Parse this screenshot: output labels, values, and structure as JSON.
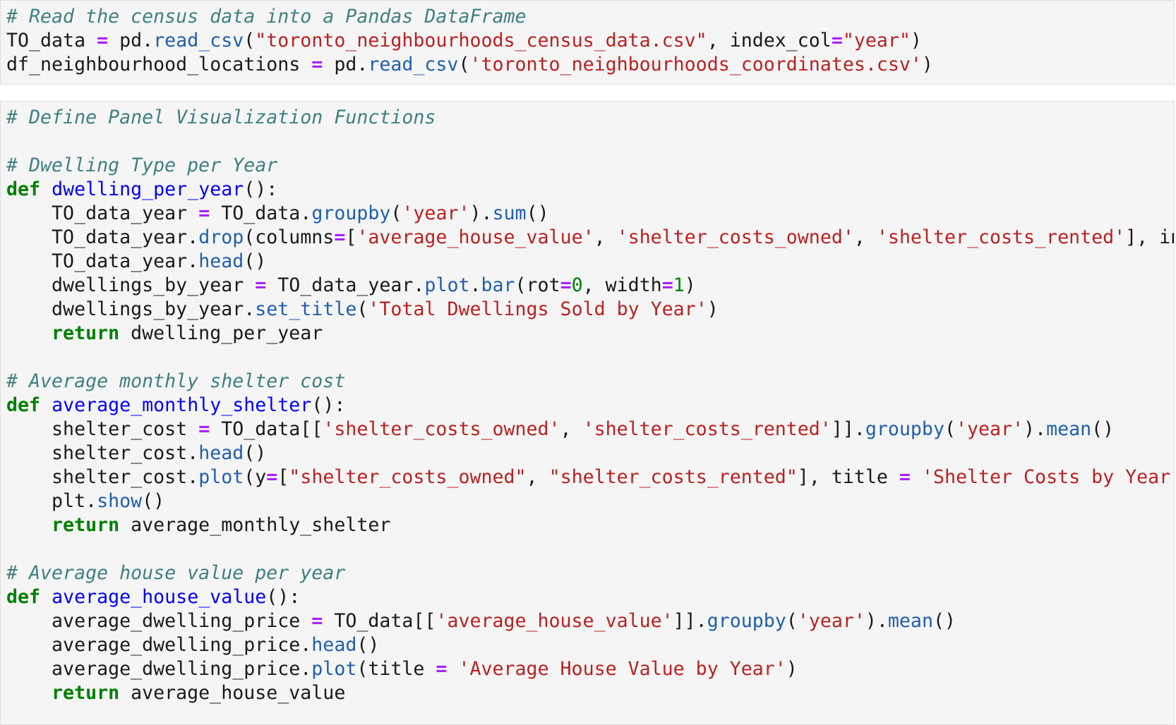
{
  "cells": [
    {
      "lines": [
        [
          [
            "comment",
            "# Read the census data into a Pandas DataFrame"
          ]
        ],
        [
          [
            "name",
            "TO_data "
          ],
          [
            "op",
            "="
          ],
          [
            "name",
            " pd."
          ],
          [
            "attr",
            "read_csv"
          ],
          [
            "punct",
            "("
          ],
          [
            "str",
            "\"toronto_neighbourhoods_census_data.csv\""
          ],
          [
            "punct",
            ", index_col"
          ],
          [
            "op",
            "="
          ],
          [
            "str",
            "\"year\""
          ],
          [
            "punct",
            ")"
          ]
        ],
        [
          [
            "name",
            "df_neighbourhood_locations "
          ],
          [
            "op",
            "="
          ],
          [
            "name",
            " pd."
          ],
          [
            "attr",
            "read_csv"
          ],
          [
            "punct",
            "("
          ],
          [
            "str",
            "'toronto_neighbourhoods_coordinates.csv'"
          ],
          [
            "punct",
            ")"
          ]
        ]
      ]
    },
    {
      "lines": [
        [
          [
            "comment",
            "# Define Panel Visualization Functions"
          ]
        ],
        [],
        [
          [
            "comment",
            "# Dwelling Type per Year"
          ]
        ],
        [
          [
            "kw",
            "def"
          ],
          [
            "name",
            " "
          ],
          [
            "def",
            "dwelling_per_year"
          ],
          [
            "punct",
            "():"
          ]
        ],
        [
          [
            "name",
            "    TO_data_year "
          ],
          [
            "op",
            "="
          ],
          [
            "name",
            " TO_data."
          ],
          [
            "attr",
            "groupby"
          ],
          [
            "punct",
            "("
          ],
          [
            "str",
            "'year'"
          ],
          [
            "punct",
            ")."
          ],
          [
            "attr",
            "sum"
          ],
          [
            "punct",
            "()"
          ]
        ],
        [
          [
            "name",
            "    TO_data_year."
          ],
          [
            "attr",
            "drop"
          ],
          [
            "punct",
            "(columns"
          ],
          [
            "op",
            "="
          ],
          [
            "punct",
            "["
          ],
          [
            "str",
            "'average_house_value'"
          ],
          [
            "punct",
            ", "
          ],
          [
            "str",
            "'shelter_costs_owned'"
          ],
          [
            "punct",
            ", "
          ],
          [
            "str",
            "'shelter_costs_rented'"
          ],
          [
            "punct",
            "], inpl"
          ]
        ],
        [
          [
            "name",
            "    TO_data_year."
          ],
          [
            "attr",
            "head"
          ],
          [
            "punct",
            "()"
          ]
        ],
        [
          [
            "name",
            "    dwellings_by_year "
          ],
          [
            "op",
            "="
          ],
          [
            "name",
            " TO_data_year."
          ],
          [
            "attr",
            "plot"
          ],
          [
            "punct",
            "."
          ],
          [
            "attr",
            "bar"
          ],
          [
            "punct",
            "(rot"
          ],
          [
            "op",
            "="
          ],
          [
            "num",
            "0"
          ],
          [
            "punct",
            ", width"
          ],
          [
            "op",
            "="
          ],
          [
            "num",
            "1"
          ],
          [
            "punct",
            ")"
          ]
        ],
        [
          [
            "name",
            "    dwellings_by_year."
          ],
          [
            "attr",
            "set_title"
          ],
          [
            "punct",
            "("
          ],
          [
            "str",
            "'Total Dwellings Sold by Year'"
          ],
          [
            "punct",
            ")"
          ]
        ],
        [
          [
            "kw",
            "    return"
          ],
          [
            "name",
            " dwelling_per_year"
          ]
        ],
        [],
        [
          [
            "comment",
            "# Average monthly shelter cost"
          ]
        ],
        [
          [
            "kw",
            "def"
          ],
          [
            "name",
            " "
          ],
          [
            "def",
            "average_monthly_shelter"
          ],
          [
            "punct",
            "():"
          ]
        ],
        [
          [
            "name",
            "    shelter_cost "
          ],
          [
            "op",
            "="
          ],
          [
            "name",
            " TO_data[["
          ],
          [
            "str",
            "'shelter_costs_owned'"
          ],
          [
            "punct",
            ", "
          ],
          [
            "str",
            "'shelter_costs_rented'"
          ],
          [
            "punct",
            "]]."
          ],
          [
            "attr",
            "groupby"
          ],
          [
            "punct",
            "("
          ],
          [
            "str",
            "'year'"
          ],
          [
            "punct",
            ")."
          ],
          [
            "attr",
            "mean"
          ],
          [
            "punct",
            "()"
          ]
        ],
        [
          [
            "name",
            "    shelter_cost."
          ],
          [
            "attr",
            "head"
          ],
          [
            "punct",
            "()"
          ]
        ],
        [
          [
            "name",
            "    shelter_cost."
          ],
          [
            "attr",
            "plot"
          ],
          [
            "punct",
            "(y"
          ],
          [
            "op",
            "="
          ],
          [
            "punct",
            "["
          ],
          [
            "str",
            "\"shelter_costs_owned\""
          ],
          [
            "punct",
            ", "
          ],
          [
            "str",
            "\"shelter_costs_rented\""
          ],
          [
            "punct",
            "], title "
          ],
          [
            "op",
            "="
          ],
          [
            "punct",
            " "
          ],
          [
            "str",
            "'Shelter Costs by Year'"
          ],
          [
            "punct",
            ")"
          ]
        ],
        [
          [
            "name",
            "    plt."
          ],
          [
            "attr",
            "show"
          ],
          [
            "punct",
            "()"
          ]
        ],
        [
          [
            "kw",
            "    return"
          ],
          [
            "name",
            " average_monthly_shelter"
          ]
        ],
        [],
        [
          [
            "comment",
            "# Average house value per year"
          ]
        ],
        [
          [
            "kw",
            "def"
          ],
          [
            "name",
            " "
          ],
          [
            "def",
            "average_house_value"
          ],
          [
            "punct",
            "():"
          ]
        ],
        [
          [
            "name",
            "    average_dwelling_price "
          ],
          [
            "op",
            "="
          ],
          [
            "name",
            " TO_data[["
          ],
          [
            "str",
            "'average_house_value'"
          ],
          [
            "punct",
            "]]."
          ],
          [
            "attr",
            "groupby"
          ],
          [
            "punct",
            "("
          ],
          [
            "str",
            "'year'"
          ],
          [
            "punct",
            ")."
          ],
          [
            "attr",
            "mean"
          ],
          [
            "punct",
            "()"
          ]
        ],
        [
          [
            "name",
            "    average_dwelling_price."
          ],
          [
            "attr",
            "head"
          ],
          [
            "punct",
            "()"
          ]
        ],
        [
          [
            "name",
            "    average_dwelling_price."
          ],
          [
            "attr",
            "plot"
          ],
          [
            "punct",
            "(title "
          ],
          [
            "op",
            "="
          ],
          [
            "punct",
            " "
          ],
          [
            "str",
            "'Average House Value by Year'"
          ],
          [
            "punct",
            ")"
          ]
        ],
        [
          [
            "kw",
            "    return"
          ],
          [
            "name",
            " average_house_value"
          ]
        ]
      ]
    }
  ]
}
